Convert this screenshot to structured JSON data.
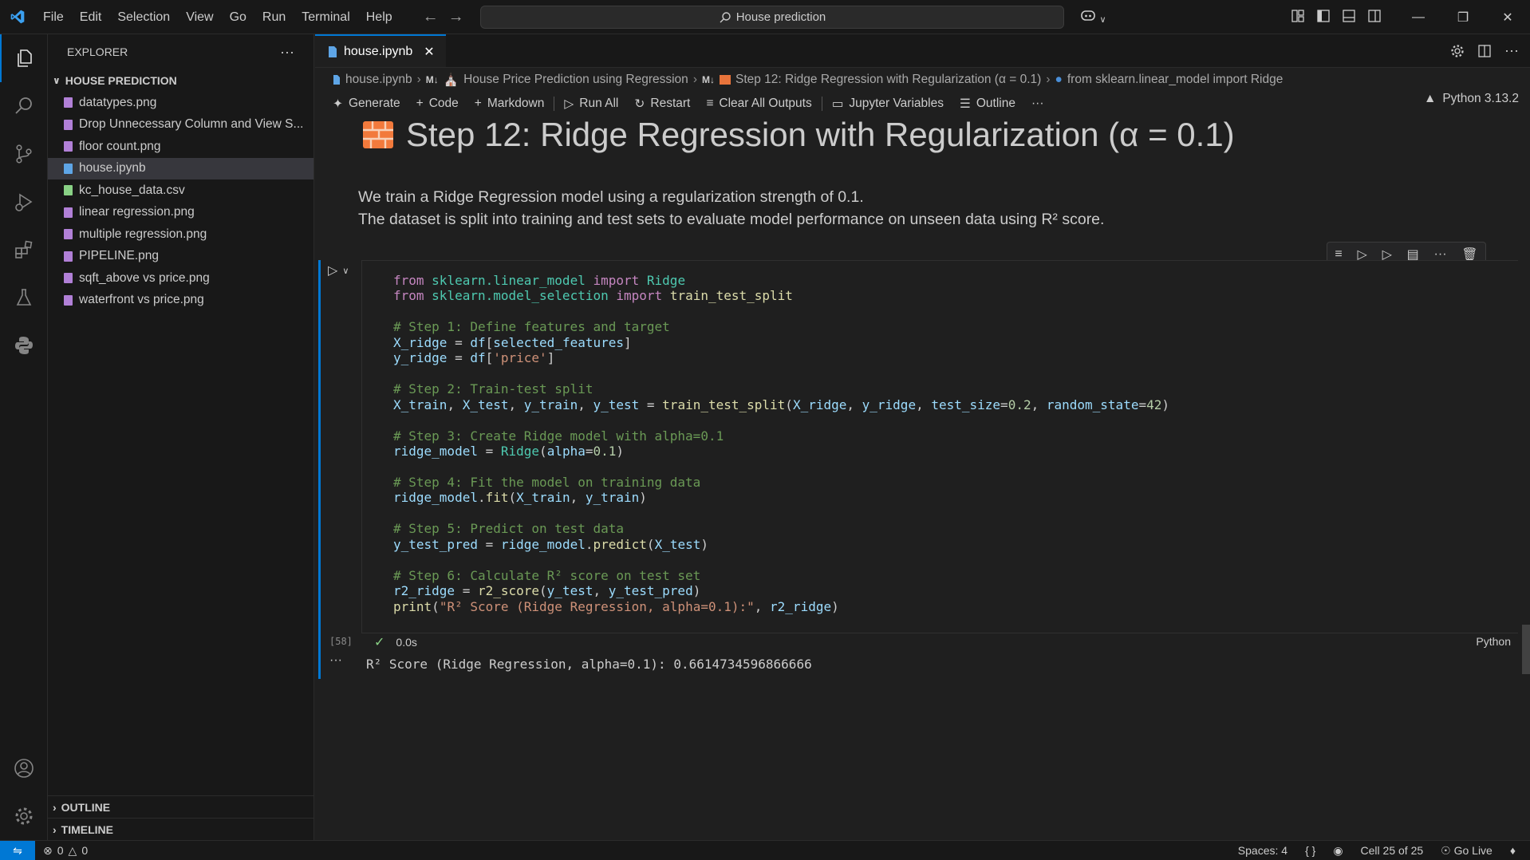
{
  "menu": [
    "File",
    "Edit",
    "Selection",
    "View",
    "Go",
    "Run",
    "Terminal",
    "Help"
  ],
  "search": {
    "text": "House prediction"
  },
  "sidebar": {
    "title": "EXPLORER",
    "folder": "HOUSE PREDICTION",
    "files": [
      {
        "name": "datatypes.png",
        "type": "image"
      },
      {
        "name": "Drop Unnecessary Column and View S...",
        "type": "image"
      },
      {
        "name": "floor count.png",
        "type": "image"
      },
      {
        "name": "house.ipynb",
        "type": "notebook",
        "selected": true
      },
      {
        "name": "kc_house_data.csv",
        "type": "csv"
      },
      {
        "name": "linear regression.png",
        "type": "image"
      },
      {
        "name": "multiple regression.png",
        "type": "image"
      },
      {
        "name": "PIPELINE.png",
        "type": "image"
      },
      {
        "name": "sqft_above vs price.png",
        "type": "image"
      },
      {
        "name": "waterfront vs price.png",
        "type": "image"
      }
    ],
    "outline": "OUTLINE",
    "timeline": "TIMELINE"
  },
  "tab": {
    "name": "house.ipynb"
  },
  "breadcrumb": {
    "file": "house.ipynb",
    "md_badge": "M↓",
    "section1": "House Price Prediction using Regression",
    "section2": "Step 12: Ridge Regression with Regularization (α = 0.1)",
    "section3": "from sklearn.linear_model import Ridge"
  },
  "toolbar": {
    "generate": "Generate",
    "code": "Code",
    "markdown": "Markdown",
    "run_all": "Run All",
    "restart": "Restart",
    "clear": "Clear All Outputs",
    "variables": "Jupyter Variables",
    "outline": "Outline",
    "more": "···",
    "kernel": "Python 3.13.2"
  },
  "markdown_cell": {
    "heading": "Step 12: Ridge Regression with Regularization (α = 0.1)",
    "line1": "We train a Ridge Regression model using a regularization strength of 0.1.",
    "line2": "The dataset is split into training and test sets to evaluate model performance on unseen data using R² score."
  },
  "code_cell": {
    "exec_count": "[58]",
    "duration": "0.0s",
    "language": "Python",
    "output": "R² Score (Ridge Regression, alpha=0.1): 0.6614734596866666"
  },
  "statusbar": {
    "errors": "0",
    "warnings": "0",
    "spaces": "Spaces: 4",
    "braces": "{ }",
    "cell": "Cell 25 of 25",
    "golive": "Go Live"
  },
  "colors": {
    "accent": "#0078d4",
    "background": "#1f1f1f",
    "sidebar": "#181818"
  }
}
